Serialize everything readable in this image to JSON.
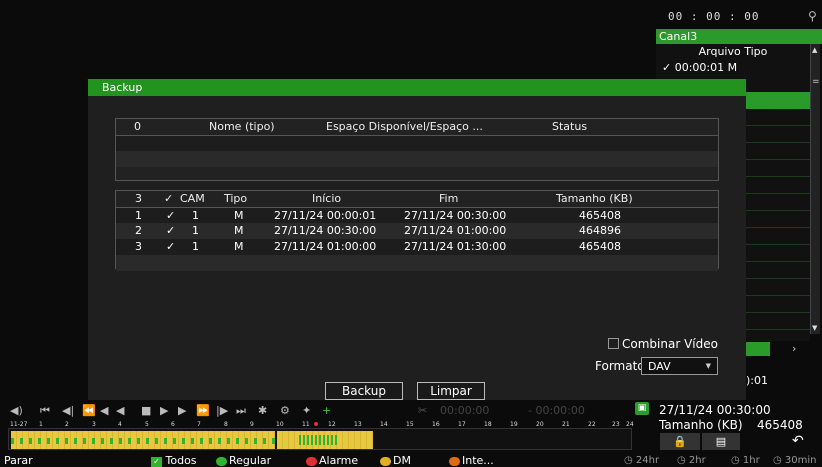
{
  "right_panel": {
    "time": "00 : 00 : 00",
    "channel": "Canal3",
    "header": "Arquivo Tipo",
    "first_item": "00:00:01 M",
    "arrow": "›",
    "time_suffix": "):01"
  },
  "dialog": {
    "title": "Backup",
    "devices_table": {
      "headers": [
        "0",
        "Nome (tipo)",
        "Espaço Disponível/Espaço ...",
        "Status"
      ]
    },
    "files_table": {
      "count": "3",
      "headers": [
        "CAM",
        "Tipo",
        "Início",
        "Fim",
        "Tamanho (KB)"
      ],
      "rows": [
        {
          "num": "1",
          "cam": "1",
          "tipo": "M",
          "inicio": "27/11/24 00:00:01",
          "fim": "27/11/24 00:30:00",
          "tamanho": "465408"
        },
        {
          "num": "2",
          "cam": "1",
          "tipo": "M",
          "inicio": "27/11/24 00:30:00",
          "fim": "27/11/24 01:00:00",
          "tamanho": "464896"
        },
        {
          "num": "3",
          "cam": "1",
          "tipo": "M",
          "inicio": "27/11/24 01:00:00",
          "fim": "27/11/24 01:30:00",
          "tamanho": "465408"
        }
      ]
    },
    "combine_label": "Combinar Vídeo",
    "format_label": "Formato",
    "format_value": "DAV",
    "backup_button": "Backup",
    "clear_button": "Limpar"
  },
  "playback": {
    "time_start": "00:00:00",
    "time_end": "- 00:00:00",
    "datetime": "27/11/24 00:30:00",
    "size_label": "Tamanho (KB)",
    "size_value": "465408",
    "timeline_ticks": [
      "11-27",
      "1",
      "2",
      "3",
      "4",
      "5",
      "6",
      "7",
      "8",
      "9",
      "10",
      "11",
      "12",
      "13",
      "14",
      "15",
      "16",
      "17",
      "18",
      "19",
      "20",
      "21",
      "22",
      "23",
      "24"
    ]
  },
  "statusbar": {
    "stop": "Parar",
    "all": "Todos",
    "regular": "Regular",
    "alarm": "Alarme",
    "dm": "DM",
    "inte": "Inte...",
    "zoom": [
      "24hr",
      "2hr",
      "1hr",
      "30min"
    ]
  },
  "colors": {
    "accent": "#22931f",
    "regular": "#2fb52f",
    "alarm": "#e03030",
    "dm": "#e0b020",
    "inte": "#e06a10",
    "timeline_yellow": "#e8c840"
  }
}
